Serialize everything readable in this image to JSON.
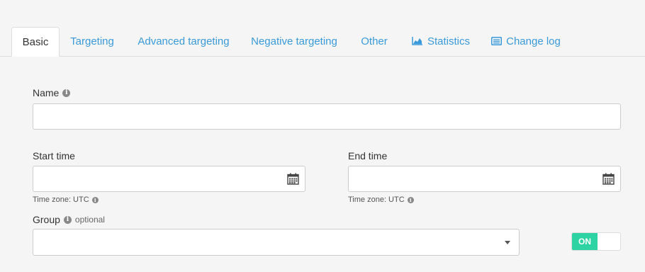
{
  "tabs": [
    {
      "label": "Basic",
      "active": true
    },
    {
      "label": "Targeting"
    },
    {
      "label": "Advanced targeting"
    },
    {
      "label": "Negative targeting"
    },
    {
      "label": "Other"
    },
    {
      "label": "Statistics",
      "icon": "area-chart-icon"
    },
    {
      "label": "Change log",
      "icon": "list-icon"
    }
  ],
  "form": {
    "name_label": "Name",
    "name_value": "",
    "start_label": "Start time",
    "start_value": "",
    "end_label": "End time",
    "end_value": "",
    "timezone_hint": "Time zone: UTC",
    "group_label": "Group",
    "group_optional": "optional",
    "group_value": "",
    "toggle_label": "ON"
  },
  "colors": {
    "link": "#3a9ad9",
    "toggle_on": "#2ed3a4"
  }
}
